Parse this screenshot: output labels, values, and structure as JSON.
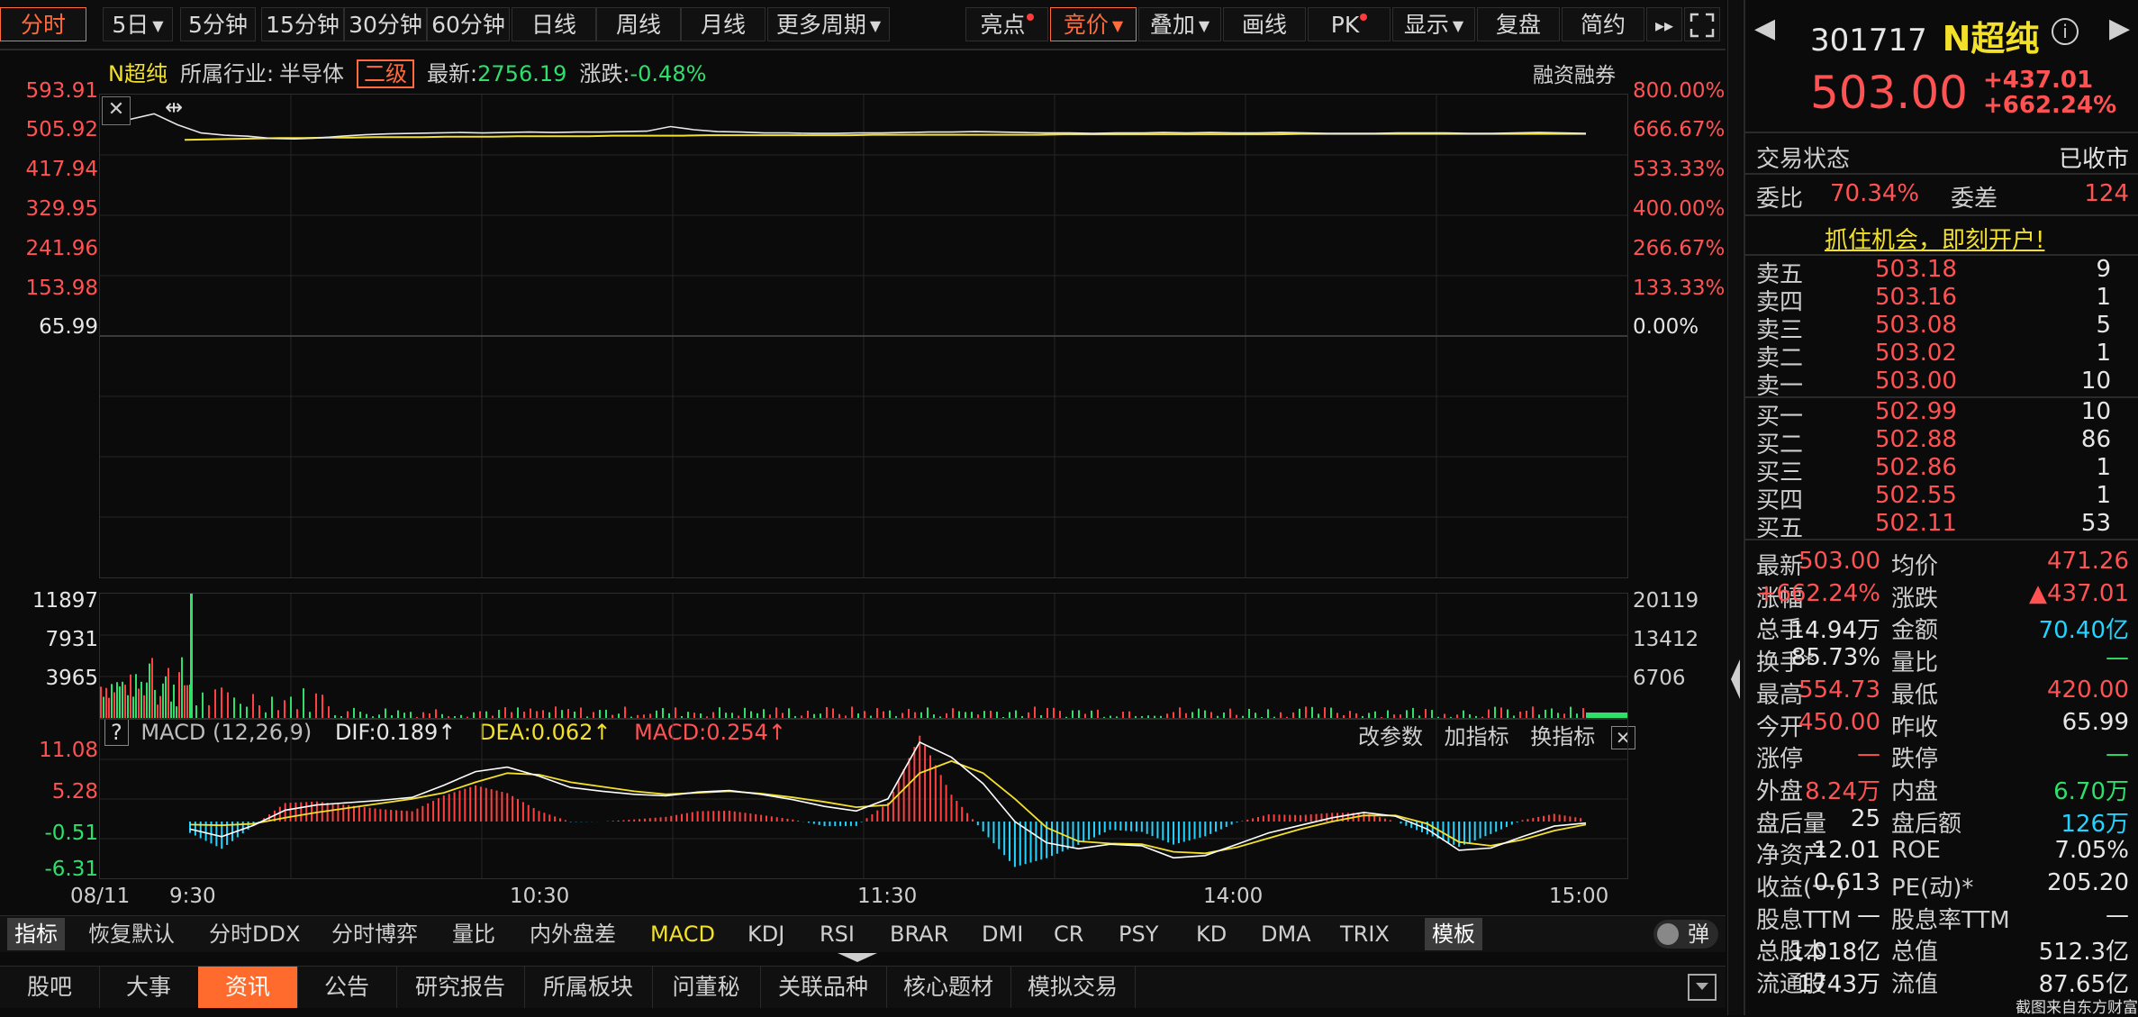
{
  "toolbar": {
    "periods": [
      "分时",
      "5日",
      "5分钟",
      "15分钟",
      "30分钟",
      "60分钟",
      "日线",
      "周线",
      "月线",
      "更多周期"
    ],
    "tools": [
      "亮点",
      "竞价",
      "叠加",
      "画线",
      "PK",
      "显示",
      "复盘",
      "简约"
    ],
    "forward_icon": "double-chevron-right-icon",
    "fullscreen_icon": "expand-icon"
  },
  "info": {
    "name": "N超纯",
    "industry_label": "所属行业:",
    "industry": "半导体",
    "level": "二级",
    "latest_label": "最新:",
    "latest": "2756.19",
    "change_label": "涨跌:",
    "change": "-0.48%",
    "margin": "融资融券"
  },
  "price_chart": {
    "y_left": [
      "593.91",
      "505.92",
      "417.94",
      "329.95",
      "241.96",
      "153.98",
      "65.99"
    ],
    "y_right": [
      "800.00%",
      "666.67%",
      "533.33%",
      "400.00%",
      "266.67%",
      "133.33%",
      "0.00%"
    ],
    "ylim": [
      65.99,
      593.91
    ],
    "price_series": [
      540,
      552,
      528,
      510,
      505,
      503,
      498,
      497,
      499,
      503,
      506,
      508,
      509,
      510,
      511,
      510,
      511,
      512,
      511,
      512,
      512,
      513,
      514,
      524,
      517,
      513,
      512,
      510,
      510,
      509,
      509,
      510,
      510,
      511,
      512,
      512,
      513,
      512,
      511,
      510,
      510,
      509,
      510,
      510,
      511,
      510,
      511,
      510,
      510,
      511,
      510,
      509,
      509,
      509,
      510,
      510,
      510,
      509,
      509,
      510,
      511,
      510,
      509
    ],
    "avg_series": [
      495,
      496,
      497,
      498,
      499,
      499,
      500,
      500,
      501,
      501,
      501,
      502,
      502,
      502,
      503,
      503,
      503,
      503,
      504,
      504,
      504,
      504,
      505,
      505,
      505,
      505,
      505,
      505,
      505,
      506,
      506,
      506,
      506,
      506,
      506,
      506,
      506,
      507,
      507,
      507,
      507,
      507,
      507,
      507,
      507,
      507,
      507,
      508,
      508,
      508,
      508,
      508,
      508,
      508,
      508,
      508,
      508,
      508,
      508,
      508
    ]
  },
  "volume_chart": {
    "y_left": [
      "11897",
      "7931",
      "3965"
    ],
    "y_right": [
      "20119",
      "13412",
      "6706"
    ],
    "max": 11897
  },
  "macd": {
    "help": "?",
    "title": "MACD (12,26,9)",
    "dif_label": "DIF:0.189↑",
    "dea_label": "DEA:0.062↑",
    "macd_label": "MACD:0.254↑",
    "actions": [
      "改参数",
      "加指标",
      "换指标"
    ],
    "y_left": [
      "11.08",
      "5.28",
      "-0.51",
      "-6.31"
    ],
    "ylim": [
      -6.31,
      11.08
    ],
    "dif": [
      -1.0,
      -2.0,
      -0.5,
      1.5,
      2.2,
      2.5,
      2.8,
      3.2,
      4.8,
      6.6,
      7.2,
      6.0,
      4.5,
      4.0,
      3.6,
      3.4,
      3.9,
      4.1,
      3.6,
      2.9,
      2.0,
      1.4,
      3.0,
      10.5,
      8.5,
      5.0,
      0.0,
      -2.8,
      -3.6,
      -3.0,
      -3.2,
      -4.8,
      -4.5,
      -3.0,
      -1.5,
      -0.5,
      0.5,
      1.2,
      0.7,
      -1.0,
      -3.8,
      -3.5,
      -2.0,
      -0.6,
      -0.2
    ],
    "dea": [
      -0.4,
      -0.5,
      -0.3,
      0.5,
      1.2,
      1.8,
      2.4,
      3.0,
      3.8,
      5.2,
      6.4,
      6.2,
      5.2,
      4.6,
      4.0,
      3.6,
      3.8,
      4.0,
      3.7,
      3.2,
      2.6,
      1.9,
      2.2,
      6.4,
      8.0,
      6.4,
      3.0,
      -0.8,
      -2.6,
      -2.9,
      -3.0,
      -4.0,
      -4.2,
      -3.4,
      -2.2,
      -1.0,
      0.0,
      0.8,
      0.8,
      -0.3,
      -2.7,
      -3.2,
      -2.4,
      -1.2,
      -0.4
    ],
    "dates": [
      "08/11",
      "9:30",
      "10:30",
      "11:30",
      "14:00",
      "15:00"
    ]
  },
  "indicators": {
    "items": [
      "指标",
      "恢复默认",
      "分时DDX",
      "分时博弈",
      "量比",
      "内外盘差",
      "MACD",
      "KDJ",
      "RSI",
      "BRAR",
      "DMI",
      "CR",
      "PSY",
      "KD",
      "DMA",
      "TRIX",
      "模板"
    ],
    "toggle_label": "弹"
  },
  "bottom_tabs": [
    "股吧",
    "大事",
    "资讯",
    "公告",
    "研究报告",
    "所属板块",
    "问董秘",
    "关联品种",
    "核心题材",
    "模拟交易"
  ],
  "quote": {
    "code": "301717",
    "name": "N超纯",
    "price": "503.00",
    "change": "+437.01",
    "change_pct": "+662.24%",
    "status_label": "交易状态",
    "status": "已收市",
    "wb_label": "委比",
    "wb": "70.34%",
    "wc_label": "委差",
    "wc": "124",
    "promo": "抓住机会，即刻开户!",
    "asks": [
      {
        "label": "卖五",
        "price": "503.18",
        "vol": "9"
      },
      {
        "label": "卖四",
        "price": "503.16",
        "vol": "1"
      },
      {
        "label": "卖三",
        "price": "503.08",
        "vol": "5"
      },
      {
        "label": "卖二",
        "price": "503.02",
        "vol": "1"
      },
      {
        "label": "卖一",
        "price": "503.00",
        "vol": "10"
      }
    ],
    "bids": [
      {
        "label": "买一",
        "price": "502.99",
        "vol": "10"
      },
      {
        "label": "买二",
        "price": "502.88",
        "vol": "86"
      },
      {
        "label": "买三",
        "price": "502.86",
        "vol": "1"
      },
      {
        "label": "买四",
        "price": "502.55",
        "vol": "1"
      },
      {
        "label": "买五",
        "price": "502.11",
        "vol": "53"
      }
    ],
    "stats": [
      [
        "最新",
        "503.00",
        "均价",
        "471.26"
      ],
      [
        "涨幅",
        "+662.24%",
        "涨跌",
        "▲437.01"
      ],
      [
        "总手",
        "14.94万",
        "金额",
        "70.40亿"
      ],
      [
        "换手*",
        "85.73%",
        "量比",
        "—"
      ],
      [
        "最高",
        "554.73",
        "最低",
        "420.00"
      ],
      [
        "今开",
        "450.00",
        "昨收",
        "65.99"
      ],
      [
        "涨停",
        "—",
        "跌停",
        "—"
      ],
      [
        "外盘",
        "8.24万",
        "内盘",
        "6.70万"
      ],
      [
        "盘后量",
        "25",
        "盘后额",
        "126万"
      ],
      [
        "净资产",
        "12.01",
        "ROE",
        "7.05%"
      ],
      [
        "收益(一)",
        "0.613",
        "PE(动)*",
        "205.20"
      ],
      [
        "股息TTM",
        "—",
        "股息率TTM",
        "—"
      ],
      [
        "总股本",
        "1.018亿",
        "总值",
        "512.3亿"
      ],
      [
        "流通股",
        "1743万",
        "流值",
        "87.65亿"
      ]
    ],
    "source": "截图来自东方财富"
  },
  "colors": {
    "up": "#ff5252",
    "down": "#2ee06a",
    "accent": "#ff6b3d",
    "price_line": "#e8e8e8",
    "avg_line": "#f2e02b",
    "dif": "#ffffff",
    "dea": "#f2e02b"
  }
}
